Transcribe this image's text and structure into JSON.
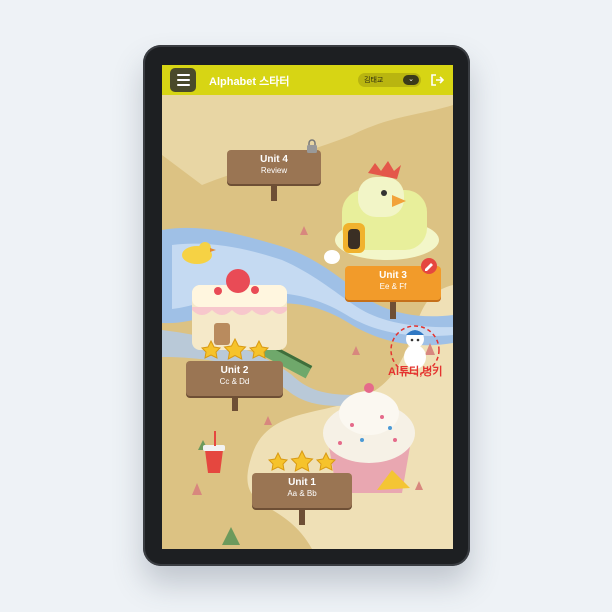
{
  "app": {
    "title": "Alphabet 스타터"
  },
  "user": {
    "name": "김태교"
  },
  "units": [
    {
      "title": "Unit 4",
      "subtitle": "Review",
      "stars": 0,
      "locked": true
    },
    {
      "title": "Unit 3",
      "subtitle": "Ee & Ff",
      "stars": 0,
      "current": true
    },
    {
      "title": "Unit 2",
      "subtitle": "Cc & Dd",
      "stars": 3
    },
    {
      "title": "Unit 1",
      "subtitle": "Aa & Bb",
      "stars": 3
    }
  ],
  "buddy": {
    "label": "AI튜터,빙키"
  },
  "icons": {
    "menu": "menu-icon",
    "logout": "logout-icon",
    "lock": "lock-icon",
    "star": "star-icon",
    "pencil": "pencil-icon"
  },
  "colors": {
    "topbar": "#d7d514",
    "sign": "#9a7553",
    "active_sign": "#f29b2a",
    "buddy_label": "#e4332f"
  }
}
